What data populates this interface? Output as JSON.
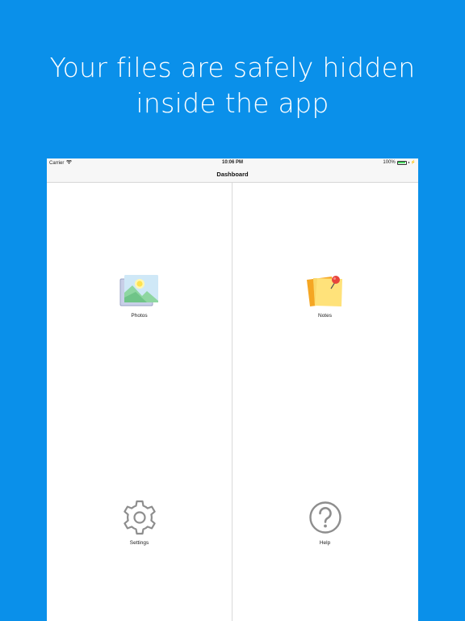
{
  "promo": {
    "headline_line1": "Your files are safely hidden",
    "headline_line2": "inside the app"
  },
  "status_bar": {
    "carrier": "Carrier",
    "time": "10:06 PM",
    "battery": "100%"
  },
  "nav": {
    "title": "Dashboard"
  },
  "dashboard": {
    "items": [
      {
        "label": "Photos",
        "icon": "photos-icon"
      },
      {
        "label": "Notes",
        "icon": "notes-icon"
      },
      {
        "label": "Settings",
        "icon": "gear-icon"
      },
      {
        "label": "Help",
        "icon": "help-icon"
      }
    ]
  },
  "colors": {
    "background": "#0a90ea",
    "device": "#ffffff",
    "icon_gray": "#8e8e8e",
    "note_orange": "#f5a623",
    "note_yellow": "#ffe27a",
    "pin_red": "#e8453c"
  }
}
